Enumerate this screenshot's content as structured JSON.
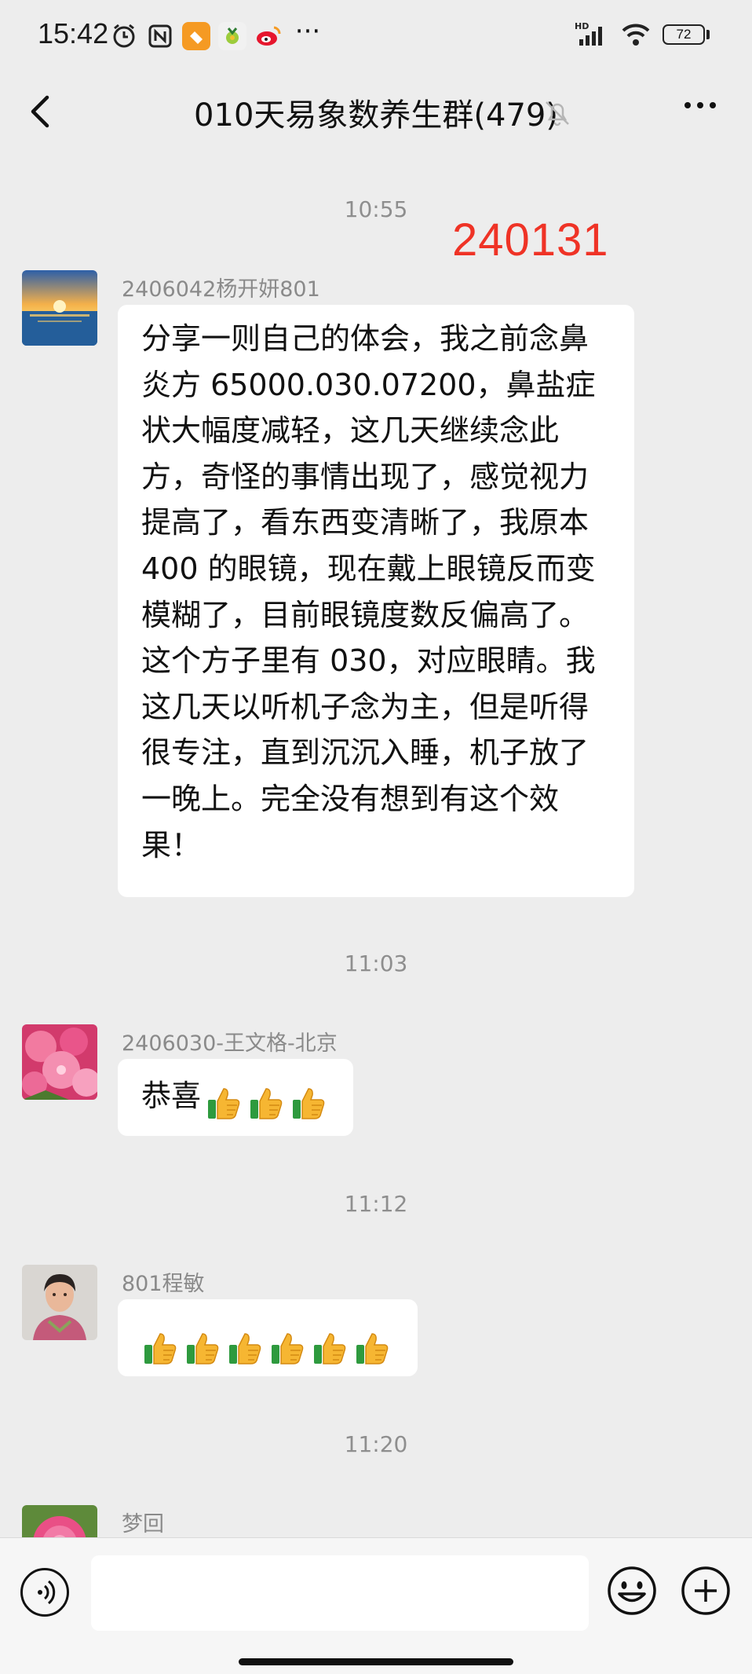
{
  "status_bar": {
    "time": "15:42",
    "battery": "72",
    "network": "HD"
  },
  "header": {
    "title": "010天易象数养生群(479)"
  },
  "messages": [
    {
      "time": "10:55",
      "stamp": "240131",
      "sender": "2406042杨开妍801",
      "text": "分享一则自己的体会，我之前念鼻\n炎方 65000.030.07200，鼻盐症\n状大幅度减轻，这几天继续念此\n方，奇怪的事情出现了，感觉视力\n提高了，看东西变清晰了，我原本\n400 的眼镜，现在戴上眼镜反而变\n模糊了，目前眼镜度数反偏高了。\n这个方子里有 030，对应眼睛。我\n这几天以听机子念为主，但是听得\n很专注，直到沉沉入睡，机子放了\n一晚上。完全没有想到有这个效\n果！"
    },
    {
      "time": "11:03",
      "sender": "2406030-王文格-北京",
      "text": "恭喜",
      "thumbs": 3
    },
    {
      "time": "11:12",
      "sender": "801程敏",
      "text": "",
      "thumbs": 6
    },
    {
      "time": "11:20",
      "sender": "梦回"
    }
  ],
  "icons": [
    "back-icon",
    "mute-bell-icon",
    "more-icon",
    "voice-icon",
    "emoji-icon",
    "plus-icon",
    "thumbs-up-icon"
  ],
  "colors": {
    "background": "#ededed",
    "bubble": "#ffffff",
    "stamp": "#ef3326"
  }
}
